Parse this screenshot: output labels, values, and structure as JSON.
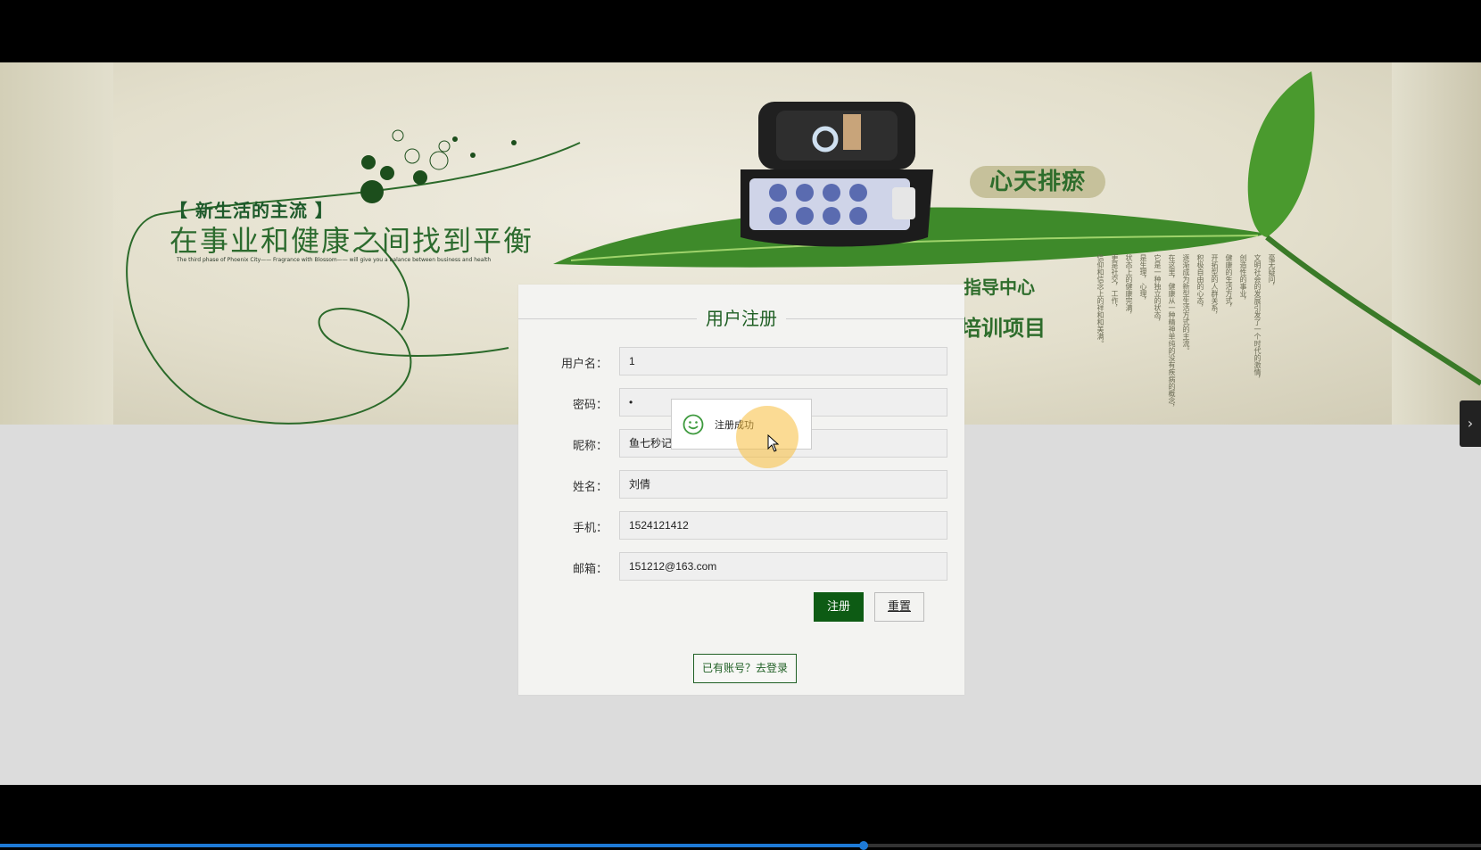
{
  "banner": {
    "slogan_bracket": "【 新生活的主流 】",
    "slogan_main": "在事业和健康之间找到平衡",
    "slogan_small": "The third phase of Phoenix City—— Fragrance with Blossom—— will give you a balance between business and health",
    "brand_title": "心天排瘀",
    "brand_sub1": "指导中心",
    "brand_sub2": "培训项目",
    "vertical_lines": [
      "毫无疑问，",
      "文明社会的发展引发了一个时代的激情，",
      "创造性的事业，",
      "健康的生活方式，",
      "开拓型的人群关系，",
      "积极自由的心态，",
      "逐渐成为新型生活方式的主流。",
      "在这里，健康从一种精神单纯的没有疾病的概念，",
      "它是一种独立的状态，",
      "是生理，心理，",
      "状态上的健康完满，",
      "更是社交，工作，",
      "信仰和信念上的祥和和美满。"
    ]
  },
  "form": {
    "title": "用户注册",
    "fields": [
      {
        "label": "用户名：",
        "value": "1"
      },
      {
        "label": "密码：",
        "value": "•"
      },
      {
        "label": "昵称：",
        "value": "鱼七秒记"
      },
      {
        "label": "姓名：",
        "value": "刘倩"
      },
      {
        "label": "手机：",
        "value": "1524121412"
      },
      {
        "label": "邮箱：",
        "value": "151212@163.com"
      }
    ],
    "submit_label": "注册",
    "reset_label": "重置",
    "login_link": "已有账号？去登录"
  },
  "toast": {
    "message": "注册成功",
    "icon": "smile-icon"
  },
  "side_tab": {
    "icon": "chevron-right-icon",
    "glyph": "›"
  },
  "player": {
    "progress_fraction": 0.583
  },
  "colors": {
    "accent_green": "#0d5b14",
    "title_green": "#1f5f24",
    "progress_blue": "#1e7ad6"
  }
}
